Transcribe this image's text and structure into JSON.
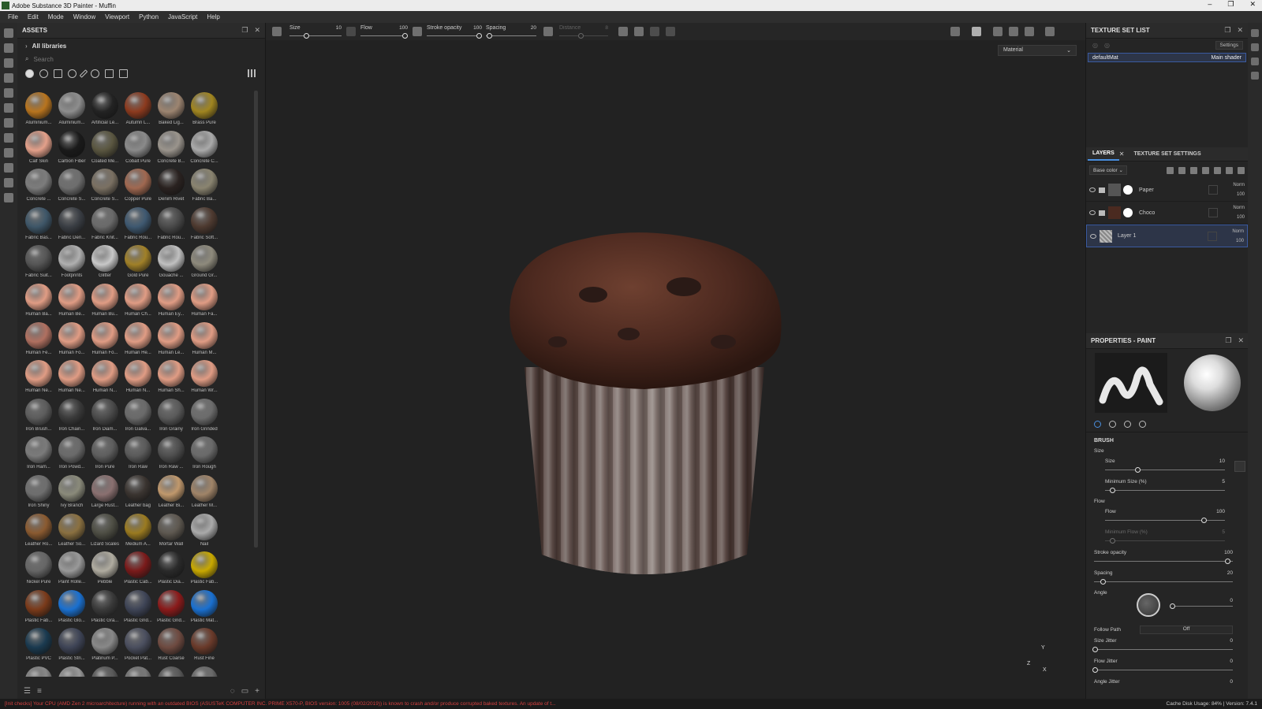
{
  "app": {
    "title": "Adobe Substance 3D Painter - Muffin"
  },
  "window_controls": [
    "–",
    "❐",
    "✕"
  ],
  "menu": [
    "File",
    "Edit",
    "Mode",
    "Window",
    "Viewport",
    "Python",
    "JavaScript",
    "Help"
  ],
  "assets": {
    "title": "ASSETS",
    "libraries": "All libraries",
    "search_placeholder": "Search",
    "items": [
      {
        "name": "Aluminium...",
        "color": "#b8741e"
      },
      {
        "name": "Aluminium...",
        "color": "#8d8d8d"
      },
      {
        "name": "Artificial Le...",
        "color": "#232323"
      },
      {
        "name": "Autumn L...",
        "color": "#8c3a1e"
      },
      {
        "name": "Baked Lig...",
        "color": "#9c8470"
      },
      {
        "name": "Brass Pure",
        "color": "#a08520"
      },
      {
        "name": "Calf Skin",
        "color": "#e4a08a"
      },
      {
        "name": "Carbon Fiber",
        "color": "#1a1a1a"
      },
      {
        "name": "Coated Me...",
        "color": "#5a5640"
      },
      {
        "name": "Cobalt Pure",
        "color": "#8a8a8a"
      },
      {
        "name": "Concrete B...",
        "color": "#9a948c"
      },
      {
        "name": "Concrete C...",
        "color": "#aaaaaa"
      },
      {
        "name": "Concrete ...",
        "color": "#7c7c7c"
      },
      {
        "name": "Concrete S...",
        "color": "#6e6e6e"
      },
      {
        "name": "Concrete S...",
        "color": "#7a7062"
      },
      {
        "name": "Copper Pure",
        "color": "#a06850"
      },
      {
        "name": "Denim Rivet",
        "color": "#2a2220"
      },
      {
        "name": "Fabric Ba...",
        "color": "#8a8470"
      },
      {
        "name": "Fabric Bas...",
        "color": "#3e5668"
      },
      {
        "name": "Fabric Den...",
        "color": "#3a3e44"
      },
      {
        "name": "Fabric Knit...",
        "color": "#6a6a6a"
      },
      {
        "name": "Fabric Rou...",
        "color": "#3e5870"
      },
      {
        "name": "Fabric Rou...",
        "color": "#4a4a4a"
      },
      {
        "name": "Fabric Soft...",
        "color": "#4e3a30"
      },
      {
        "name": "Fabric Suit...",
        "color": "#555555"
      },
      {
        "name": "Footprints",
        "color": "#b0b0b0"
      },
      {
        "name": "Glitter",
        "color": "#c8c8c8"
      },
      {
        "name": "Gold Pure",
        "color": "#a08028"
      },
      {
        "name": "Gouache ...",
        "color": "#c0c0c0"
      },
      {
        "name": "Ground Gr...",
        "color": "#8e8a7c"
      },
      {
        "name": "Human Ba...",
        "color": "#e09c84"
      },
      {
        "name": "Human Be...",
        "color": "#e09c84"
      },
      {
        "name": "Human Bu...",
        "color": "#e09c84"
      },
      {
        "name": "Human Ch...",
        "color": "#e09c84"
      },
      {
        "name": "Human Ey...",
        "color": "#e09c84"
      },
      {
        "name": "Human Fa...",
        "color": "#e09c84"
      },
      {
        "name": "Human Fe...",
        "color": "#b07060"
      },
      {
        "name": "Human Fo...",
        "color": "#e09c84"
      },
      {
        "name": "Human Fo...",
        "color": "#e09c84"
      },
      {
        "name": "Human He...",
        "color": "#e09c84"
      },
      {
        "name": "Human Le...",
        "color": "#e09c84"
      },
      {
        "name": "Human M...",
        "color": "#e09c84"
      },
      {
        "name": "Human Ne...",
        "color": "#e09c84"
      },
      {
        "name": "Human Ne...",
        "color": "#e09c84"
      },
      {
        "name": "Human N...",
        "color": "#e09c84"
      },
      {
        "name": "Human N...",
        "color": "#e09c84"
      },
      {
        "name": "Human Sh...",
        "color": "#e09c84"
      },
      {
        "name": "Human Wr...",
        "color": "#e09c84"
      },
      {
        "name": "Iron Brush...",
        "color": "#5c5c5c"
      },
      {
        "name": "Iron Chain...",
        "color": "#3a3a3a"
      },
      {
        "name": "Iron Diam...",
        "color": "#4a4a4a"
      },
      {
        "name": "Iron Galva...",
        "color": "#6a6a6a"
      },
      {
        "name": "Iron Grainy",
        "color": "#5a5a5a"
      },
      {
        "name": "Iron Grinded",
        "color": "#6c6c6c"
      },
      {
        "name": "Iron Ham...",
        "color": "#7a7a7a"
      },
      {
        "name": "Iron Powd...",
        "color": "#6a6a6a"
      },
      {
        "name": "Iron Pure",
        "color": "#5e5e5e"
      },
      {
        "name": "Iron Raw",
        "color": "#5a5a5a"
      },
      {
        "name": "Iron Raw ...",
        "color": "#4e4e4e"
      },
      {
        "name": "Iron Rough",
        "color": "#6a6a6a"
      },
      {
        "name": "Iron Shiny",
        "color": "#6e6e6e"
      },
      {
        "name": "Ivy Branch",
        "color": "#8a8a7a"
      },
      {
        "name": "Large Rust...",
        "color": "#8a7070"
      },
      {
        "name": "Leather bag",
        "color": "#3a3430"
      },
      {
        "name": "Leather Bi...",
        "color": "#c0986c"
      },
      {
        "name": "Leather M...",
        "color": "#a08468"
      },
      {
        "name": "Leather Ro...",
        "color": "#8a5a30"
      },
      {
        "name": "Leather So...",
        "color": "#8a7040"
      },
      {
        "name": "Lizard Scales",
        "color": "#4e4e44"
      },
      {
        "name": "Medium A...",
        "color": "#9a7a20"
      },
      {
        "name": "Mortar Wall",
        "color": "#5e5850"
      },
      {
        "name": "Nail",
        "color": "#aaaaaa"
      },
      {
        "name": "Nickel Pure",
        "color": "#666666"
      },
      {
        "name": "Paint Rolle...",
        "color": "#999999"
      },
      {
        "name": "Pebble",
        "color": "#b0aca0"
      },
      {
        "name": "Plastic Cab...",
        "color": "#7a1a1a"
      },
      {
        "name": "Plastic Dia...",
        "color": "#2a2a2a"
      },
      {
        "name": "Plastic Fab...",
        "color": "#c8a800"
      },
      {
        "name": "Plastic Fab...",
        "color": "#7a3a1a"
      },
      {
        "name": "Plastic Glo...",
        "color": "#1a70d0"
      },
      {
        "name": "Plastic Gra...",
        "color": "#3a3a3a"
      },
      {
        "name": "Plastic Grid...",
        "color": "#3e4456"
      },
      {
        "name": "Plastic Grid...",
        "color": "#8a1a1a"
      },
      {
        "name": "Plastic Mat...",
        "color": "#1a70d0"
      },
      {
        "name": "Plastic PVC",
        "color": "#1a3a50"
      },
      {
        "name": "Plastic Stri...",
        "color": "#3e4456"
      },
      {
        "name": "Platinum P...",
        "color": "#888888"
      },
      {
        "name": "Pocket Pat...",
        "color": "#4a4e5e"
      },
      {
        "name": "Rust Coarse",
        "color": "#6e4a40"
      },
      {
        "name": "Rust Fine",
        "color": "#6a3a2a"
      },
      {
        "name": "",
        "color": "#888888"
      },
      {
        "name": "",
        "color": "#999999"
      },
      {
        "name": "",
        "color": "#5a5a5a"
      },
      {
        "name": "",
        "color": "#777777"
      },
      {
        "name": "",
        "color": "#5a5a5a"
      },
      {
        "name": "",
        "color": "#6a6a6a"
      }
    ]
  },
  "context_toolbar": {
    "size_label": "Size",
    "size_value": "10",
    "flow_label": "Flow",
    "flow_value": "100",
    "stroke_opacity_label": "Stroke opacity",
    "stroke_opacity_value": "100",
    "spacing_label": "Spacing",
    "spacing_value": "20",
    "distance_label": "Distance",
    "distance_value": "8"
  },
  "viewport": {
    "mode": "Material",
    "axis_y": "Y",
    "axis_z": "Z",
    "axis_x": "X"
  },
  "texture_set_list": {
    "title": "TEXTURE SET LIST",
    "settings": "Settings",
    "items": [
      {
        "name": "defaultMat",
        "shader": "Main shader"
      }
    ]
  },
  "layers": {
    "tabs": [
      "LAYERS",
      "TEXTURE SET SETTINGS"
    ],
    "channel": "Base color",
    "items": [
      {
        "name": "Paper",
        "blend": "Norm",
        "opacity": "100",
        "selected": false
      },
      {
        "name": "Choco",
        "blend": "Norm",
        "opacity": "100",
        "selected": false
      },
      {
        "name": "Layer 1",
        "blend": "Norm",
        "opacity": "100",
        "selected": true
      }
    ]
  },
  "properties": {
    "title": "PROPERTIES - PAINT",
    "section": "BRUSH",
    "size_group": "Size",
    "size_label": "Size",
    "size_value": "10",
    "min_size_label": "Minimum Size (%)",
    "min_size_value": "5",
    "flow_group": "Flow",
    "flow_label": "Flow",
    "flow_value": "100",
    "min_flow_label": "Minimum Flow (%)",
    "min_flow_value": "5",
    "stroke_opacity_label": "Stroke opacity",
    "stroke_opacity_value": "100",
    "spacing_label": "Spacing",
    "spacing_value": "20",
    "angle_label": "Angle",
    "angle_value": "0",
    "follow_path_label": "Follow Path",
    "follow_path_value": "Off",
    "size_jitter_label": "Size Jitter",
    "size_jitter_value": "0",
    "flow_jitter_label": "Flow Jitter",
    "flow_jitter_value": "0",
    "angle_jitter_label": "Angle Jitter",
    "angle_jitter_value": "0"
  },
  "status": {
    "error": "[Init checks] Your CPU (AMD Zen 2 microarchitecture) running with an outdated BIOS (ASUSTeK COMPUTER INC. PRIME X570-P, BIOS version: 1005 (08/02/2019)) is known to crash and/or produce corrupted baked textures. An update of t...",
    "info": "Cache Disk Usage:   84% | Version: 7.4.1"
  }
}
